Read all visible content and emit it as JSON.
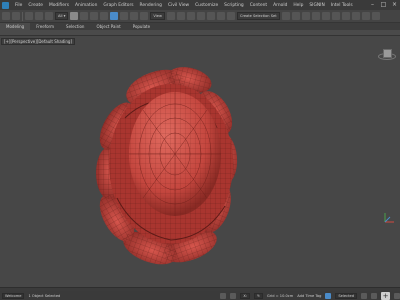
{
  "menu": {
    "items": [
      "File",
      "Create",
      "Modifiers",
      "Animation",
      "Graph Editors",
      "Rendering",
      "Civil View",
      "Customize",
      "Scripting",
      "Content",
      "Arnold",
      "Help",
      "SIGNIN",
      "Intel Tools"
    ]
  },
  "toolbar": {
    "selection_set_value": "Create Selection Set",
    "view_dropdown": "View"
  },
  "ribbon": {
    "tabs": [
      "Modeling",
      "Freeform",
      "Selection",
      "Object Paint",
      "Populate"
    ],
    "active_tab_index": 0
  },
  "viewport": {
    "label": "[+][Perspective][Default Shading]",
    "model_color": "#c8463f"
  },
  "status": {
    "selected_text": "1 Object Selected",
    "grid_text": "Grid = 10.0cm",
    "add_time_tag": "Add Time Tag",
    "auto_key": "Auto",
    "selected_dropdown": "Selected"
  },
  "colors": {
    "accent": "#4a8bc9",
    "model_red": "#c8463f",
    "viewport_bg": "#474747"
  }
}
